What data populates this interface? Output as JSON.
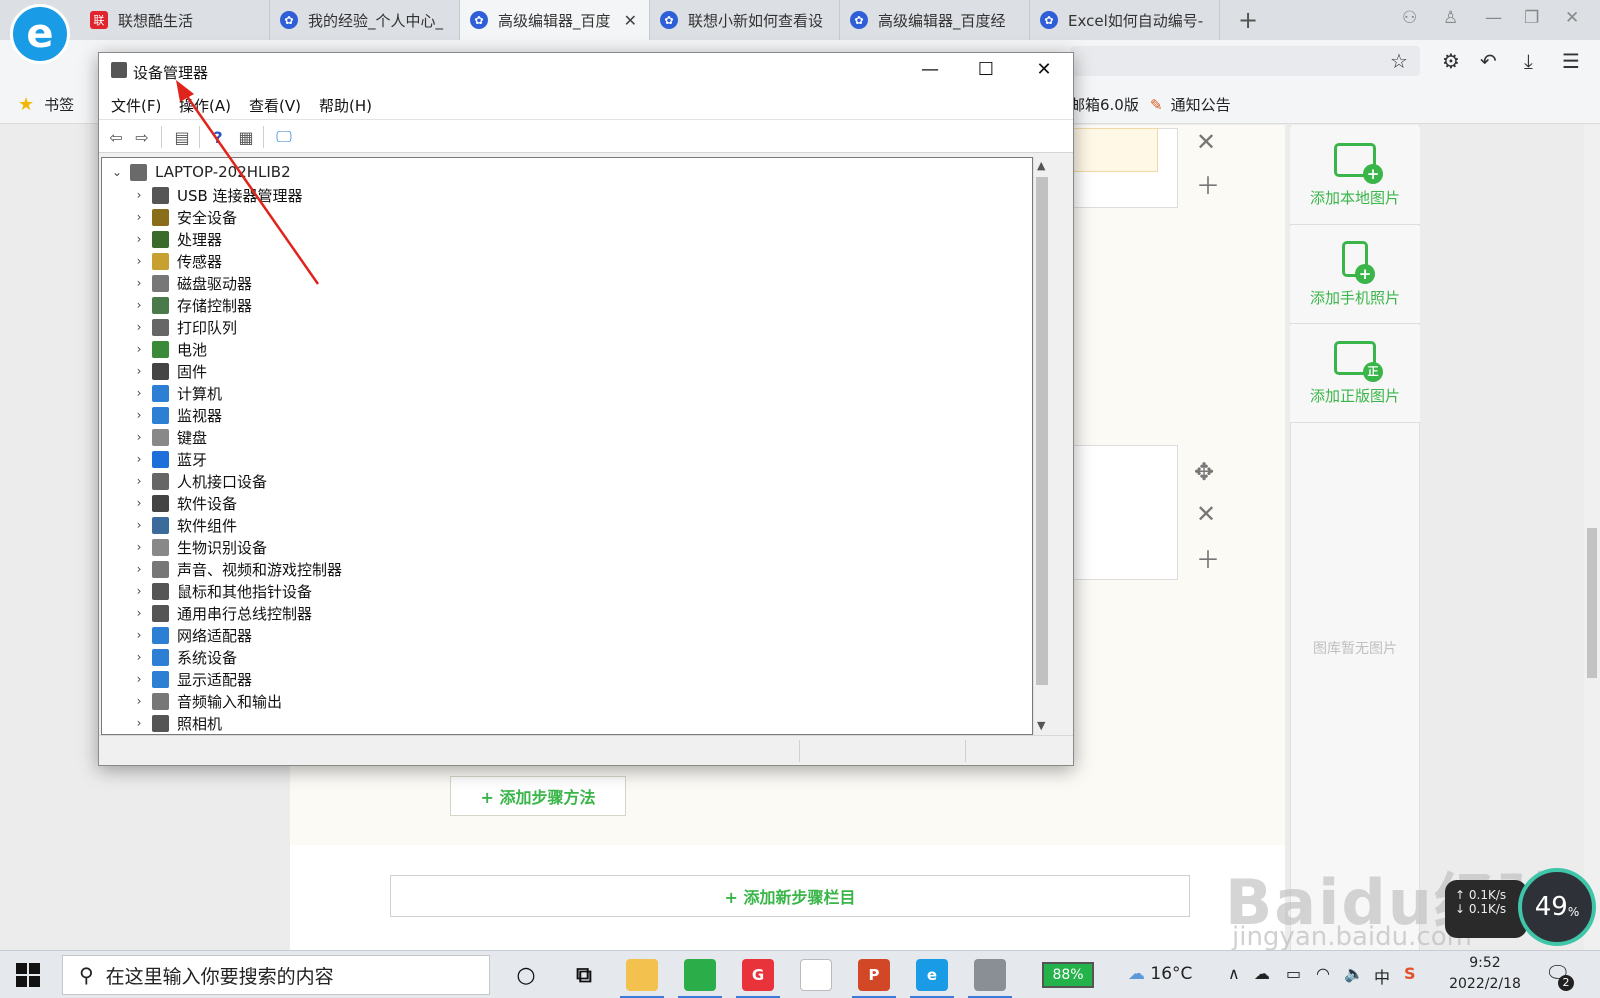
{
  "browser": {
    "tabs": [
      {
        "label": "联想酷生活",
        "icon": "lenovo-icon",
        "active": false
      },
      {
        "label": "我的经验_个人中心_",
        "icon": "baidu-paw-icon",
        "active": false
      },
      {
        "label": "高级编辑器_百度",
        "icon": "baidu-paw-icon",
        "active": true
      },
      {
        "label": "联想小新如何查看设",
        "icon": "baidu-paw-icon",
        "active": false
      },
      {
        "label": "高级编辑器_百度经",
        "icon": "baidu-paw-icon",
        "active": false
      },
      {
        "label": "Excel如何自动编号-",
        "icon": "baidu-paw-icon",
        "active": false
      }
    ],
    "new_tab_symbol": "+",
    "bookmarks": {
      "label": "书签",
      "mail_label": "邮箱6.0版",
      "notice_label": "通知公告"
    },
    "colors": {
      "accent": "#1a9be6",
      "tab_active": "#f4f5f7"
    }
  },
  "page": {
    "add_method_button": "+ 添加步骤方法",
    "add_step_button": "+ 添加新步骤栏目",
    "side_panel": {
      "add_local": "添加本地图片",
      "add_phone": "添加手机照片",
      "add_licensed": "添加正版图片",
      "empty": "图库暂无图片",
      "licensed_badge": "正"
    },
    "accent_color": "#3ab549",
    "watermark": "Baidu经验",
    "watermark_url": "jingyan.baidu.com",
    "net_widget": {
      "speed_up": "0.1",
      "speed_down": "0.1",
      "unit": "K/s",
      "percent": "49",
      "percent_sign": "%"
    }
  },
  "device_manager": {
    "title": "设备管理器",
    "menu": [
      "文件(F)",
      "操作(A)",
      "查看(V)",
      "帮助(H)"
    ],
    "root": "LAPTOP-202HLIB2",
    "items": [
      {
        "label": "USB 连接器管理器",
        "icon": "usb-icon",
        "color": "#555555"
      },
      {
        "label": "安全设备",
        "icon": "security-key-icon",
        "color": "#8a6d1a"
      },
      {
        "label": "处理器",
        "icon": "cpu-icon",
        "color": "#3a6b2a"
      },
      {
        "label": "传感器",
        "icon": "sensor-icon",
        "color": "#c8a030"
      },
      {
        "label": "磁盘驱动器",
        "icon": "disk-icon",
        "color": "#777777"
      },
      {
        "label": "存储控制器",
        "icon": "storage-controller-icon",
        "color": "#4a7a4a"
      },
      {
        "label": "打印队列",
        "icon": "printer-icon",
        "color": "#666666"
      },
      {
        "label": "电池",
        "icon": "battery-icon",
        "color": "#3a8a3a"
      },
      {
        "label": "固件",
        "icon": "firmware-icon",
        "color": "#444444"
      },
      {
        "label": "计算机",
        "icon": "computer-icon",
        "color": "#2d7fd3"
      },
      {
        "label": "监视器",
        "icon": "monitor-icon",
        "color": "#2d7fd3"
      },
      {
        "label": "键盘",
        "icon": "keyboard-icon",
        "color": "#888888"
      },
      {
        "label": "蓝牙",
        "icon": "bluetooth-icon",
        "color": "#1e6fd9"
      },
      {
        "label": "人机接口设备",
        "icon": "hid-icon",
        "color": "#666666"
      },
      {
        "label": "软件设备",
        "icon": "software-device-icon",
        "color": "#444444"
      },
      {
        "label": "软件组件",
        "icon": "software-component-icon",
        "color": "#3a6b9a"
      },
      {
        "label": "生物识别设备",
        "icon": "fingerprint-icon",
        "color": "#888888"
      },
      {
        "label": "声音、视频和游戏控制器",
        "icon": "speaker-icon",
        "color": "#777777"
      },
      {
        "label": "鼠标和其他指针设备",
        "icon": "mouse-icon",
        "color": "#555555"
      },
      {
        "label": "通用串行总线控制器",
        "icon": "usb-controller-icon",
        "color": "#555555"
      },
      {
        "label": "网络适配器",
        "icon": "network-adapter-icon",
        "color": "#2d7fd3"
      },
      {
        "label": "系统设备",
        "icon": "system-device-icon",
        "color": "#2d7fd3"
      },
      {
        "label": "显示适配器",
        "icon": "display-adapter-icon",
        "color": "#2d7fd3"
      },
      {
        "label": "音频输入和输出",
        "icon": "audio-icon",
        "color": "#777777"
      },
      {
        "label": "照相机",
        "icon": "camera-icon",
        "color": "#555555"
      }
    ]
  },
  "taskbar": {
    "search_placeholder": "在这里输入你要搜索的内容",
    "battery": "88%",
    "temperature": "16°C",
    "ime": "中",
    "time": "9:52",
    "date": "2022/2/18",
    "notification_count": "2",
    "apps": [
      {
        "name": "cortana-icon",
        "glyph": "○"
      },
      {
        "name": "task-view-icon",
        "glyph": "⧉"
      },
      {
        "name": "file-explorer-icon",
        "glyph": ""
      },
      {
        "name": "wechat-icon",
        "glyph": ""
      },
      {
        "name": "app-red-icon",
        "glyph": "G"
      },
      {
        "name": "document-icon",
        "glyph": ""
      },
      {
        "name": "powerpoint-icon",
        "glyph": "P"
      },
      {
        "name": "browser-icon",
        "glyph": "e"
      },
      {
        "name": "device-manager-icon",
        "glyph": ""
      }
    ]
  }
}
